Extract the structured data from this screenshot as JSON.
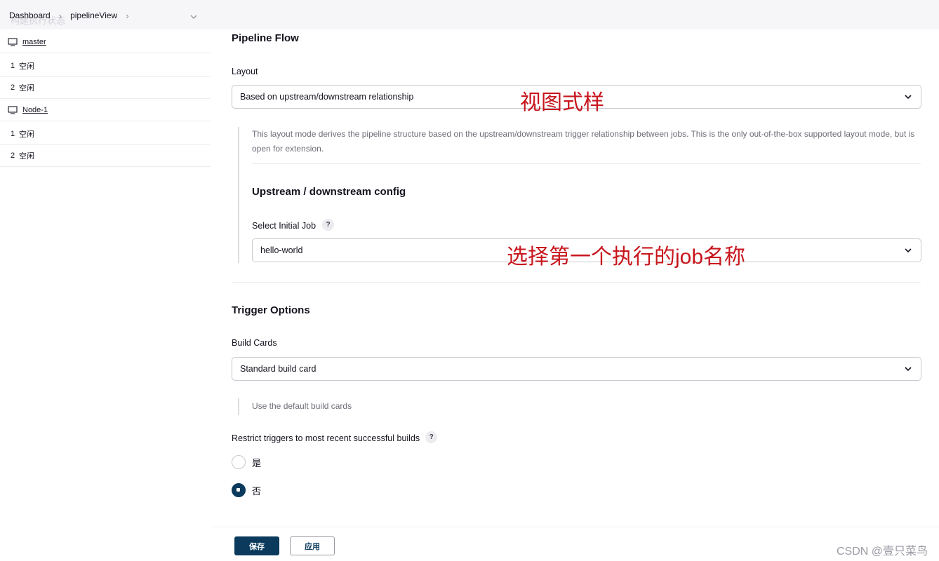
{
  "breadcrumb": {
    "items": [
      "Dashboard",
      "pipelineView"
    ]
  },
  "sidebar": {
    "ghost_title": "构建执行状态",
    "nodes": [
      {
        "name": "master",
        "executors": [
          {
            "num": "1",
            "status": "空闲"
          },
          {
            "num": "2",
            "status": "空闲"
          }
        ]
      },
      {
        "name": "Node-1",
        "executors": [
          {
            "num": "1",
            "status": "空闲"
          },
          {
            "num": "2",
            "status": "空闲"
          }
        ]
      }
    ]
  },
  "pipeline_flow": {
    "title": "Pipeline Flow",
    "layout_label": "Layout",
    "layout_value": "Based on upstream/downstream relationship",
    "layout_description": "This layout mode derives the pipeline structure based on the upstream/downstream trigger relationship between jobs. This is the only out-of-the-box supported layout mode, but is open for extension.",
    "upstream_title": "Upstream / downstream config",
    "initial_job_label": "Select Initial Job",
    "initial_job_value": "hello-world"
  },
  "trigger_options": {
    "title": "Trigger Options",
    "build_cards_label": "Build Cards",
    "build_cards_value": "Standard build card",
    "build_cards_description": "Use the default build cards",
    "restrict_label": "Restrict triggers to most recent successful builds",
    "radio_yes": "是",
    "radio_no": "否",
    "selected": "否"
  },
  "help_glyph": "?",
  "annotations": {
    "layout_note": "视图式样",
    "job_note": "选择第一个执行的job名称"
  },
  "buttons": {
    "save": "保存",
    "apply": "应用"
  },
  "watermark": "CSDN @壹只菜鸟",
  "colors": {
    "primary": "#0b3a5c",
    "annotation": "#c8161d"
  }
}
